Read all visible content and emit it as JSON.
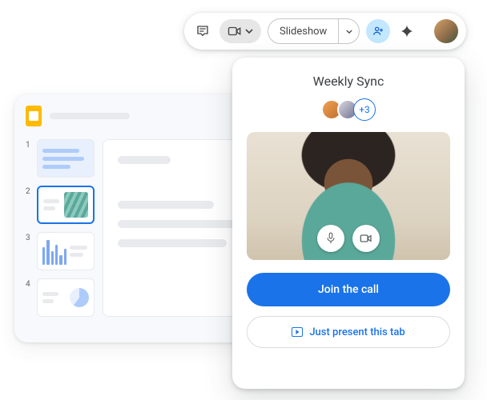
{
  "toolbar": {
    "slideshow_label": "Slideshow"
  },
  "editor": {
    "thumb_numbers": [
      "1",
      "2",
      "3",
      "4"
    ]
  },
  "meet": {
    "title": "Weekly Sync",
    "more_count_label": "+3",
    "join_label": "Join the call",
    "present_label": "Just present this tab"
  }
}
